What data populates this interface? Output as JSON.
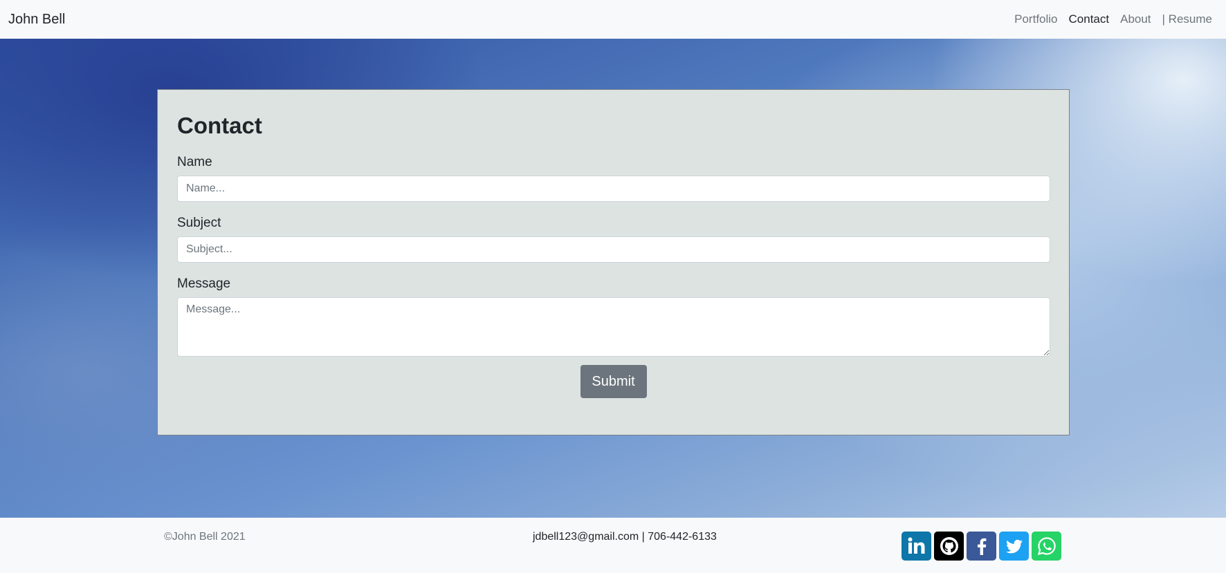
{
  "navbar": {
    "brand": "John Bell",
    "links": [
      {
        "label": "Portfolio",
        "active": false
      },
      {
        "label": "Contact",
        "active": true
      },
      {
        "label": "About",
        "active": false
      },
      {
        "label": "| Resume",
        "active": false
      }
    ]
  },
  "contact_form": {
    "title": "Contact",
    "name_label": "Name",
    "name_placeholder": "Name...",
    "subject_label": "Subject",
    "subject_placeholder": "Subject...",
    "message_label": "Message",
    "message_placeholder": "Message...",
    "submit_label": "Submit"
  },
  "footer": {
    "copyright": "©John Bell 2021",
    "contact_line": "jdbell123@gmail.com | 706-442-6133",
    "socials": [
      {
        "icon": "linkedin-icon",
        "color": "#0e76a8"
      },
      {
        "icon": "github-icon",
        "color": "#000000"
      },
      {
        "icon": "facebook-icon",
        "color": "#3b5998"
      },
      {
        "icon": "twitter-icon",
        "color": "#1da1f2"
      },
      {
        "icon": "whatsapp-icon",
        "color": "#25d366"
      }
    ]
  },
  "colors": {
    "navbar_bg": "#f8f9fa",
    "card_bg": "#dce3e1",
    "button_bg": "#6c757d",
    "muted_text": "#6c757d"
  }
}
